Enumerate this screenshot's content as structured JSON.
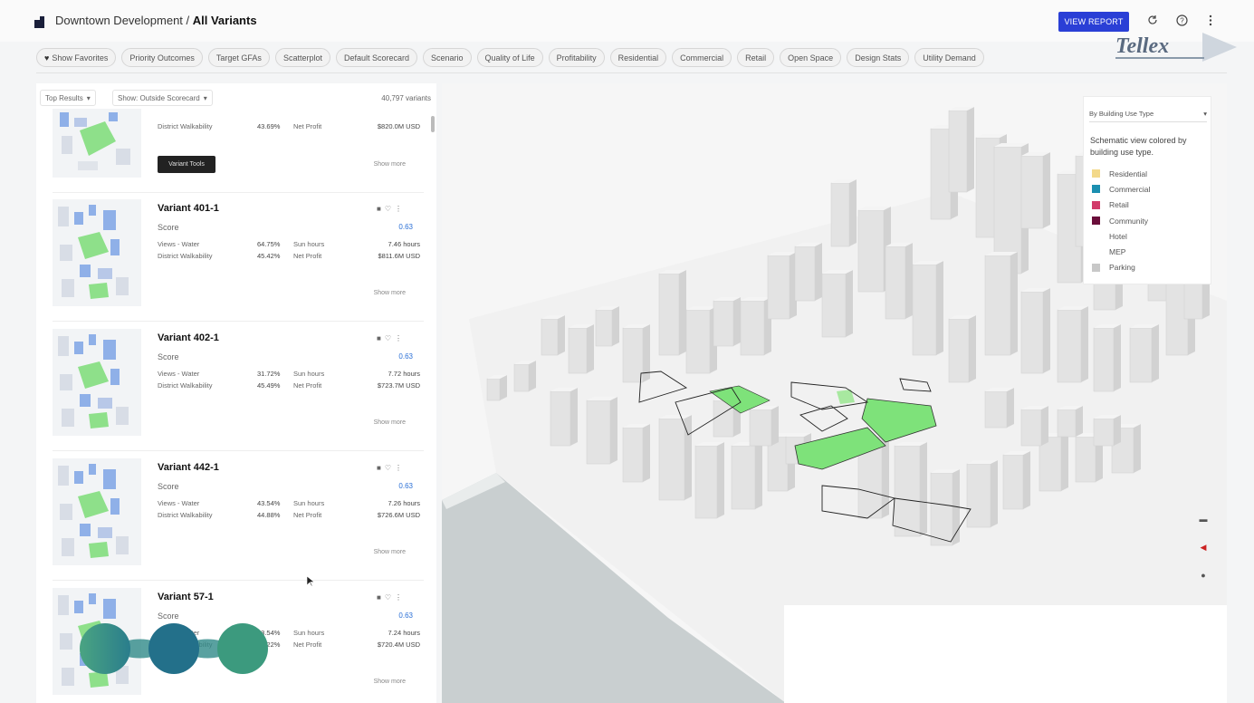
{
  "header": {
    "breadcrumb_parent": "Downtown Development",
    "breadcrumb_sep": " / ",
    "breadcrumb_current": "All Variants",
    "view_report_label": "VIEW REPORT",
    "brand_text": "Tellex"
  },
  "chips": [
    {
      "label": "Show Favorites",
      "icon": "heart-icon"
    },
    {
      "label": "Priority Outcomes"
    },
    {
      "label": "Target GFAs"
    },
    {
      "label": "Scatterplot"
    },
    {
      "label": "Default Scorecard"
    },
    {
      "label": "Scenario"
    },
    {
      "label": "Quality of Life"
    },
    {
      "label": "Profitability"
    },
    {
      "label": "Residential"
    },
    {
      "label": "Commercial"
    },
    {
      "label": "Retail"
    },
    {
      "label": "Open Space"
    },
    {
      "label": "Design Stats"
    },
    {
      "label": "Utility Demand"
    }
  ],
  "list": {
    "sort_label": "Top Results",
    "filter_label": "Show: Outside Scorecard",
    "count_label": "40,797 variants",
    "first_card": {
      "metric_label": "District Walkability",
      "metric_pct": "43.69%",
      "metric2_label": "Net Profit",
      "metric2_value": "$820.0M USD",
      "button_label": "Variant Tools",
      "more_label": "Show more"
    },
    "variants": [
      {
        "title": "Variant 401-1",
        "score_label": "Score",
        "score_value": "0.63",
        "m1_label": "Views - Water",
        "m1_pct": "64.75%",
        "m1b_label": "Sun hours",
        "m1b_value": "7.46 hours",
        "m2_label": "District Walkability",
        "m2_pct": "45.42%",
        "m2b_label": "Net Profit",
        "m2b_value": "$811.6M USD",
        "more_label": "Show more"
      },
      {
        "title": "Variant 402-1",
        "score_label": "Score",
        "score_value": "0.63",
        "m1_label": "Views - Water",
        "m1_pct": "31.72%",
        "m1b_label": "Sun hours",
        "m1b_value": "7.72 hours",
        "m2_label": "District Walkability",
        "m2_pct": "45.49%",
        "m2b_label": "Net Profit",
        "m2b_value": "$723.7M USD",
        "more_label": "Show more"
      },
      {
        "title": "Variant 442-1",
        "score_label": "Score",
        "score_value": "0.63",
        "m1_label": "Views - Water",
        "m1_pct": "43.54%",
        "m1b_label": "Sun hours",
        "m1b_value": "7.26 hours",
        "m2_label": "District Walkability",
        "m2_pct": "44.88%",
        "m2b_label": "Net Profit",
        "m2b_value": "$726.6M USD",
        "more_label": "Show more"
      },
      {
        "title": "Variant 57-1",
        "score_label": "Score",
        "score_value": "0.63",
        "m1_label": "Views - Water",
        "m1_pct": "43.54%",
        "m1b_label": "Sun hours",
        "m1b_value": "7.24 hours",
        "m2_label": "District Walkability",
        "m2_pct": "44.22%",
        "m2b_label": "Net Profit",
        "m2b_value": "$720.4M USD",
        "more_label": "Show more"
      }
    ]
  },
  "legend": {
    "select_label": "By Building Use Type",
    "description": "Schematic view colored by building use type.",
    "items": [
      {
        "label": "Residential",
        "color": "#f3d98a"
      },
      {
        "label": "Commercial",
        "color": "#1b8fb0"
      },
      {
        "label": "Retail",
        "color": "#d23a6a"
      },
      {
        "label": "Community",
        "color": "#6a0e3a"
      },
      {
        "label": "Hotel",
        "color": "#ffffff"
      },
      {
        "label": "MEP",
        "color": "#ffffff"
      },
      {
        "label": "Parking",
        "color": "#c8c8c8"
      }
    ]
  },
  "colors": {
    "accent": "#2a3fd6",
    "green": "#7ee27a",
    "building": "#e2e2e2",
    "water": "#c9cfd0"
  }
}
